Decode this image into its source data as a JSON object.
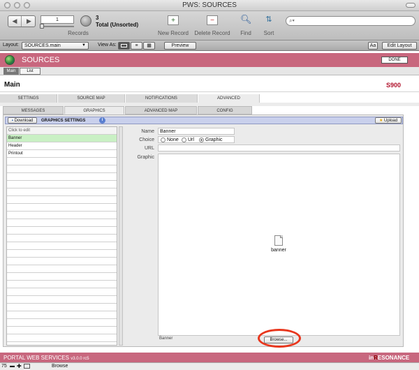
{
  "window": {
    "title": "PWS: SOURCES"
  },
  "toolbar": {
    "record_number": "1",
    "records_label": "Records",
    "record_count": "3",
    "total_label": "Total (Unsorted)",
    "new_record": "New Record",
    "delete_record": "Delete Record",
    "find": "Find",
    "sort": "Sort",
    "search_placeholder": ""
  },
  "layoutbar": {
    "layout_label": "Layout:",
    "layout_value": "SOURCES.main",
    "view_as_label": "View As:",
    "preview": "Preview",
    "aa": "Aa",
    "edit_layout": "Edit Layout"
  },
  "header": {
    "title": "SOURCES",
    "done": "DONE"
  },
  "nav": {
    "main": "Main",
    "list": "List"
  },
  "record": {
    "title": "Main",
    "id": "S900"
  },
  "tabs": [
    "SETTINGS",
    "SOURCE MAP",
    "NOTIFICATIONS",
    "ADVANCED"
  ],
  "subtabs": [
    "MESSAGES",
    "GRAPHICS",
    "ADVANCED MAP",
    "CONFIG"
  ],
  "graphics": {
    "download": "Download",
    "title": "GRAPHICS SETTINGS",
    "info": "i",
    "upload": "Upload",
    "list_header": "Click to edit",
    "items": [
      "Banner",
      "Header",
      "Printout"
    ]
  },
  "fields": {
    "name_label": "Name",
    "name_value": "Banner",
    "choice_label": "Choice",
    "choice_options": [
      "None",
      "Url",
      "Graphic"
    ],
    "choice_selected": "Graphic",
    "url_label": "URL",
    "url_value": "",
    "graphic_label": "Graphic",
    "file_name": "banner",
    "caption": "Banner",
    "browse": "Browse..."
  },
  "footer": {
    "product": "PORTAL WEB SERVICES",
    "version": "v3.0.0 rc5",
    "brand_in": "in",
    "brand_rest": "ESONANCE"
  },
  "status": {
    "zoom": "75",
    "mode": "Browse"
  },
  "colors": {
    "header_pink": "#c8677e",
    "selected_row": "#c9f0c4",
    "highlight_ring": "#e8371e"
  }
}
